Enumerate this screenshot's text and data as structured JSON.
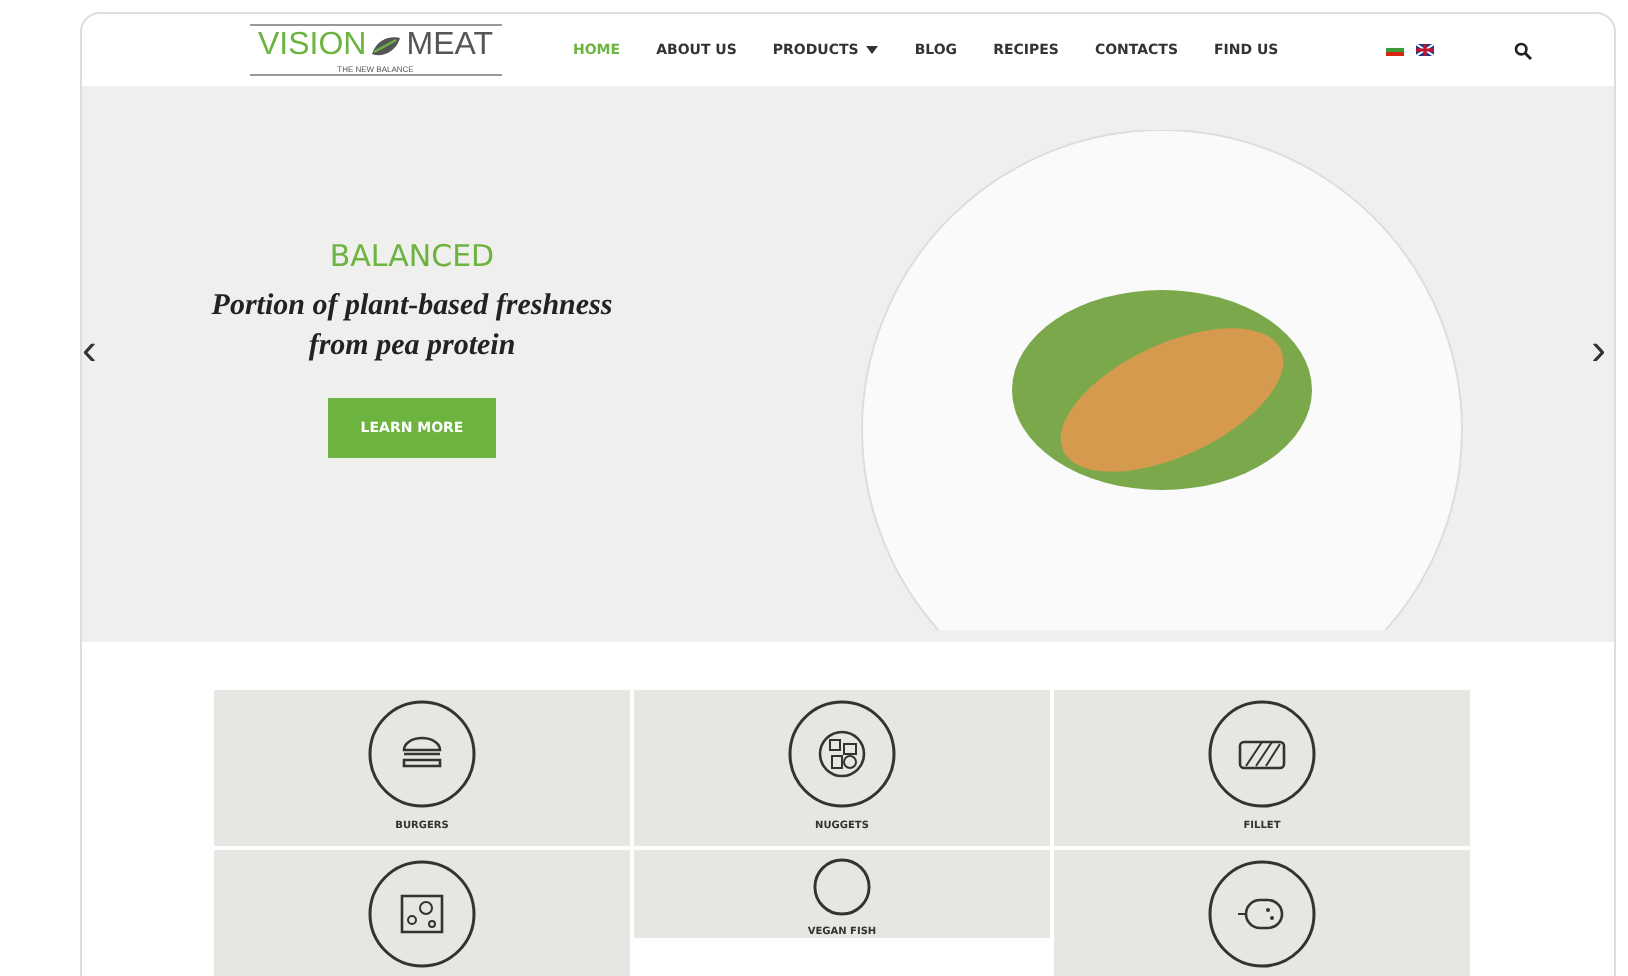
{
  "header": {
    "logo": {
      "left": "VISION",
      "right": "MEAT",
      "tagline": "THE NEW BALANCE"
    },
    "nav": [
      {
        "label": "HOME",
        "selected": true,
        "dropdown": false
      },
      {
        "label": "ABOUT US",
        "selected": false,
        "dropdown": false
      },
      {
        "label": "PRODUCTS",
        "selected": false,
        "dropdown": true
      },
      {
        "label": "BLOG",
        "selected": false,
        "dropdown": false
      },
      {
        "label": "RECIPES",
        "selected": false,
        "dropdown": false
      },
      {
        "label": "CONTACTS",
        "selected": false,
        "dropdown": false
      },
      {
        "label": "FIND US",
        "selected": false,
        "dropdown": false
      }
    ]
  },
  "hero": {
    "heading": "BALANCED",
    "text": "Portion of plant-based freshness from pea protein",
    "button": "LEARN MORE",
    "prev": "‹",
    "next": "›"
  },
  "categories": [
    {
      "kind": "burger",
      "label": "BURGERS"
    },
    {
      "kind": "nuggets",
      "label": "NUGGETS"
    },
    {
      "kind": "fillet",
      "label": "FILLET"
    },
    {
      "kind": "cheese"
    },
    {
      "kind": "blank",
      "label": "VEGAN FISH"
    },
    {
      "kind": "sausage"
    }
  ]
}
